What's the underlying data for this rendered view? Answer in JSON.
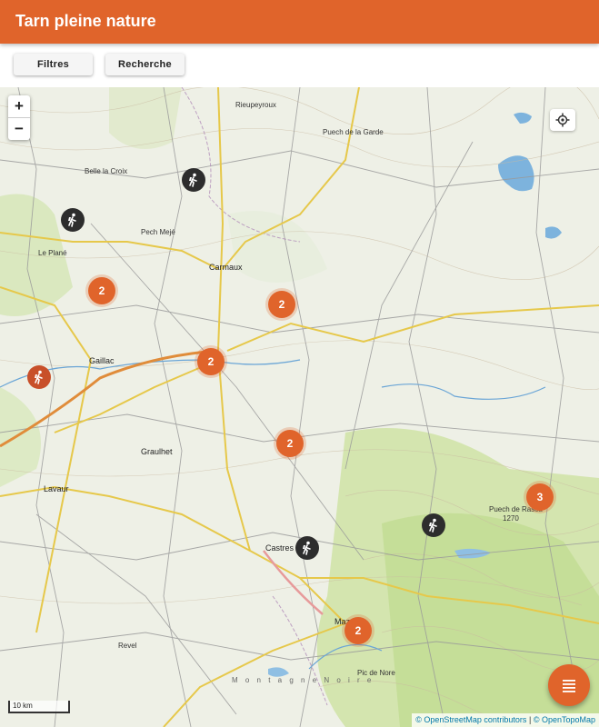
{
  "app": {
    "title": "Tarn pleine nature"
  },
  "toolbar": {
    "filters_label": "Filtres",
    "search_label": "Recherche"
  },
  "map": {
    "zoom_in_label": "+",
    "zoom_out_label": "−",
    "scale_label": "10 km",
    "attribution": {
      "osm": "© OpenStreetMap contributors",
      "separator": "|",
      "topo": "© OpenTopoMap"
    },
    "places": {
      "rieupeyroux": "Rieupeyroux",
      "puech_garde": "Puech de la Garde",
      "belle_croix": "Belle la Croix",
      "pech_meje": "Pech Mejé",
      "le_plane": "Le Plané",
      "carmaux": "Carmaux",
      "gaillac": "Gaillac",
      "graulhet": "Graulhet",
      "lavaur": "Lavaur",
      "castres": "Castres",
      "puech_rasca": "Puech de Rasca",
      "rasca_alt": "1270",
      "mazamet": "Maz",
      "revel": "Revel",
      "pic_nore": "Pic de Nore",
      "montagne": "M o n t a g n e   N o i r e"
    },
    "clusters": [
      {
        "count": "2"
      },
      {
        "count": "2"
      },
      {
        "count": "2"
      },
      {
        "count": "2"
      },
      {
        "count": "3"
      },
      {
        "count": "2"
      }
    ],
    "hiker_icon": "hiker-icon",
    "colors": {
      "accent": "#e0642b",
      "poi_dark": "#2d2d2d",
      "poi_orange": "#c8502a"
    }
  },
  "fab": {
    "icon": "list-icon"
  }
}
